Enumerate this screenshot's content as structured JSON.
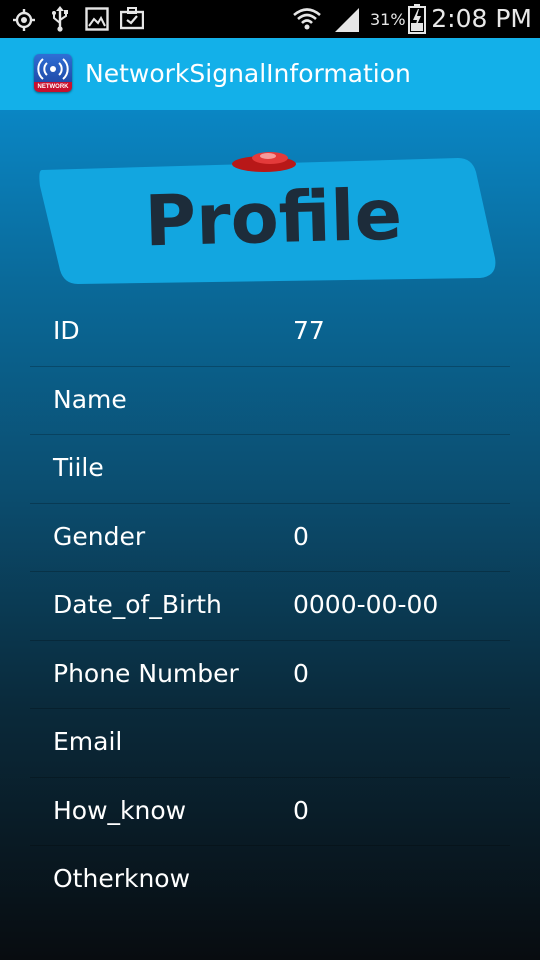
{
  "status_bar": {
    "icons": [
      "gps-icon",
      "usb-icon",
      "gallery-icon",
      "briefcase-icon",
      "wifi-icon",
      "signal-icon",
      "battery-charging-icon"
    ],
    "battery_percent": "31%",
    "time": "2:08 PM"
  },
  "app_bar": {
    "title": "NetworkSignalInformation",
    "icon_label": "NETWORK"
  },
  "banner": {
    "text": "Profile",
    "color": "#12a6e0"
  },
  "profile": {
    "rows": [
      {
        "label": "ID",
        "value": "77"
      },
      {
        "label": "Name",
        "value": ""
      },
      {
        "label": "Tiile",
        "value": ""
      },
      {
        "label": "Gender",
        "value": "0"
      },
      {
        "label": "Date_of_Birth",
        "value": "0000-00-00"
      },
      {
        "label": "Phone Number",
        "value": "0"
      },
      {
        "label": "Email",
        "value": ""
      },
      {
        "label": "How_know",
        "value": "0"
      },
      {
        "label": "Otherknow",
        "value": ""
      }
    ]
  },
  "colors": {
    "action_bar": "#13b0e9",
    "background_top": "#0a86c4",
    "background_bottom": "#080c10"
  }
}
